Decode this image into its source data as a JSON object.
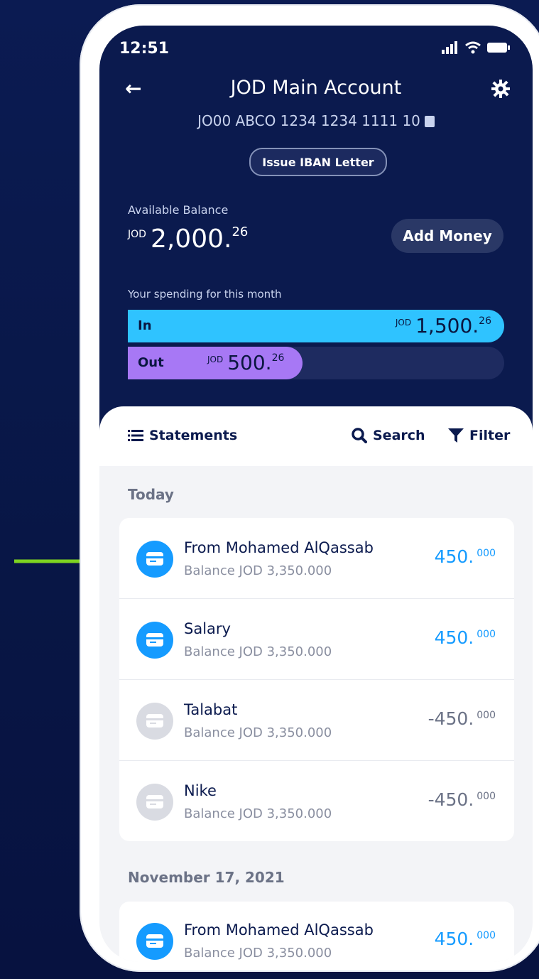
{
  "status_bar": {
    "time": "12:51"
  },
  "header": {
    "title": "JOD Main Account",
    "iban": "JO00 ABCO 1234 1234 1111 10",
    "issue_button": "Issue IBAN Letter",
    "available_label": "Available Balance",
    "balance": {
      "currency": "JOD",
      "main": "2,000.",
      "decimals": "26"
    },
    "add_money": "Add Money",
    "spending_label": "Your spending for this month",
    "in": {
      "label": "In",
      "currency": "JOD",
      "main": "1,500.",
      "decimals": "26",
      "fill_fraction": 1.0
    },
    "out": {
      "label": "Out",
      "currency": "JOD",
      "main": "500.",
      "decimals": "26",
      "fill_fraction": 0.33
    }
  },
  "toolbar": {
    "statements": "Statements",
    "search": "Search",
    "filter": "Filter"
  },
  "sections": [
    {
      "title": "Today",
      "items": [
        {
          "name": "From Mohamed AlQassab",
          "balance": "Balance JOD 3,350.000",
          "amount": "450.",
          "decimals": "000",
          "type": "credit"
        },
        {
          "name": "Salary",
          "balance": "Balance JOD 3,350.000",
          "amount": "450.",
          "decimals": "000",
          "type": "credit"
        },
        {
          "name": "Talabat",
          "balance": "Balance JOD 3,350.000",
          "amount": "-450.",
          "decimals": "000",
          "type": "debit"
        },
        {
          "name": "Nike",
          "balance": "Balance JOD 3,350.000",
          "amount": "-450.",
          "decimals": "000",
          "type": "debit"
        }
      ]
    },
    {
      "title": "November 17, 2021",
      "items": [
        {
          "name": "From Mohamed AlQassab",
          "balance": "Balance JOD 3,350.000",
          "amount": "450.",
          "decimals": "000",
          "type": "credit"
        }
      ]
    }
  ],
  "colors": {
    "header_bg": "#0b1a4e",
    "in_bar": "#2fc3ff",
    "out_bar": "#a778f5",
    "credit": "#159bff",
    "arrow": "#7ed321"
  }
}
